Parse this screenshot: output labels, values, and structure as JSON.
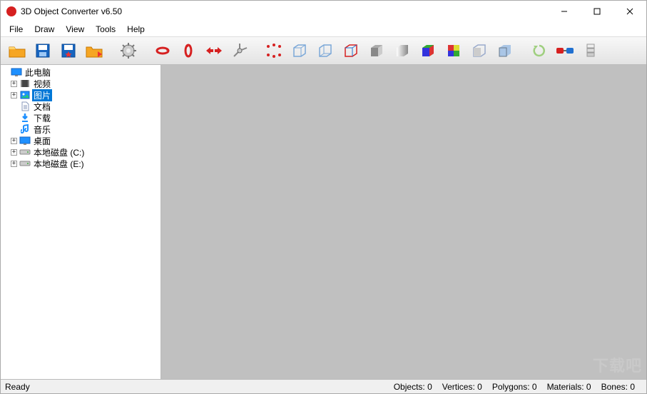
{
  "title": "3D Object Converter v6.50",
  "menubar": {
    "items": [
      "File",
      "Draw",
      "View",
      "Tools",
      "Help"
    ]
  },
  "toolbar": {
    "buttons": [
      "open-folder",
      "save",
      "save-favorite",
      "mark-folder",
      "settings",
      "rotate-x",
      "rotate-y",
      "flip",
      "axis-tool",
      "bounds",
      "wireframe-front",
      "wireframe-back",
      "wireframe-colored",
      "shade-flat",
      "shade-smooth",
      "shade-colored",
      "shade-checker",
      "half-wire",
      "half-shade",
      "refresh",
      "anaglyph",
      "extrude"
    ]
  },
  "tree": {
    "items": [
      {
        "depth": 1,
        "expandable": false,
        "icon": "monitor",
        "label": "此电脑",
        "selected": false
      },
      {
        "depth": 2,
        "expandable": true,
        "icon": "film",
        "label": "视频",
        "selected": false
      },
      {
        "depth": 2,
        "expandable": true,
        "icon": "picture",
        "label": "图片",
        "selected": true
      },
      {
        "depth": 2,
        "expandable": false,
        "icon": "doc",
        "label": "文档",
        "selected": false
      },
      {
        "depth": 2,
        "expandable": false,
        "icon": "download",
        "label": "下载",
        "selected": false
      },
      {
        "depth": 2,
        "expandable": false,
        "icon": "music",
        "label": "音乐",
        "selected": false
      },
      {
        "depth": 2,
        "expandable": true,
        "icon": "monitor",
        "label": "桌面",
        "selected": false
      },
      {
        "depth": 2,
        "expandable": true,
        "icon": "drive",
        "label": "本地磁盘 (C:)",
        "selected": false
      },
      {
        "depth": 2,
        "expandable": true,
        "icon": "drive",
        "label": "本地磁盘 (E:)",
        "selected": false
      }
    ]
  },
  "status": {
    "ready": "Ready",
    "objects_label": "Objects:",
    "objects_val": "0",
    "vertices_label": "Vertices:",
    "vertices_val": "0",
    "polygons_label": "Polygons:",
    "polygons_val": "0",
    "materials_label": "Materials:",
    "materials_val": "0",
    "bones_label": "Bones:",
    "bones_val": "0"
  },
  "watermark": "下载吧"
}
